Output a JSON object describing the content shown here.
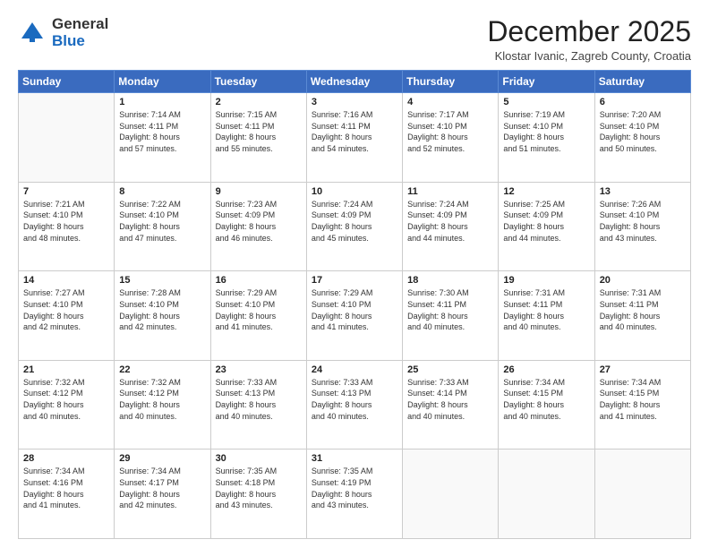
{
  "logo": {
    "general": "General",
    "blue": "Blue"
  },
  "header": {
    "month": "December 2025",
    "location": "Klostar Ivanic, Zagreb County, Croatia"
  },
  "weekdays": [
    "Sunday",
    "Monday",
    "Tuesday",
    "Wednesday",
    "Thursday",
    "Friday",
    "Saturday"
  ],
  "weeks": [
    [
      {
        "day": null,
        "detail": ""
      },
      {
        "day": "1",
        "detail": "Sunrise: 7:14 AM\nSunset: 4:11 PM\nDaylight: 8 hours\nand 57 minutes."
      },
      {
        "day": "2",
        "detail": "Sunrise: 7:15 AM\nSunset: 4:11 PM\nDaylight: 8 hours\nand 55 minutes."
      },
      {
        "day": "3",
        "detail": "Sunrise: 7:16 AM\nSunset: 4:11 PM\nDaylight: 8 hours\nand 54 minutes."
      },
      {
        "day": "4",
        "detail": "Sunrise: 7:17 AM\nSunset: 4:10 PM\nDaylight: 8 hours\nand 52 minutes."
      },
      {
        "day": "5",
        "detail": "Sunrise: 7:19 AM\nSunset: 4:10 PM\nDaylight: 8 hours\nand 51 minutes."
      },
      {
        "day": "6",
        "detail": "Sunrise: 7:20 AM\nSunset: 4:10 PM\nDaylight: 8 hours\nand 50 minutes."
      }
    ],
    [
      {
        "day": "7",
        "detail": "Sunrise: 7:21 AM\nSunset: 4:10 PM\nDaylight: 8 hours\nand 48 minutes."
      },
      {
        "day": "8",
        "detail": "Sunrise: 7:22 AM\nSunset: 4:10 PM\nDaylight: 8 hours\nand 47 minutes."
      },
      {
        "day": "9",
        "detail": "Sunrise: 7:23 AM\nSunset: 4:09 PM\nDaylight: 8 hours\nand 46 minutes."
      },
      {
        "day": "10",
        "detail": "Sunrise: 7:24 AM\nSunset: 4:09 PM\nDaylight: 8 hours\nand 45 minutes."
      },
      {
        "day": "11",
        "detail": "Sunrise: 7:24 AM\nSunset: 4:09 PM\nDaylight: 8 hours\nand 44 minutes."
      },
      {
        "day": "12",
        "detail": "Sunrise: 7:25 AM\nSunset: 4:09 PM\nDaylight: 8 hours\nand 44 minutes."
      },
      {
        "day": "13",
        "detail": "Sunrise: 7:26 AM\nSunset: 4:10 PM\nDaylight: 8 hours\nand 43 minutes."
      }
    ],
    [
      {
        "day": "14",
        "detail": "Sunrise: 7:27 AM\nSunset: 4:10 PM\nDaylight: 8 hours\nand 42 minutes."
      },
      {
        "day": "15",
        "detail": "Sunrise: 7:28 AM\nSunset: 4:10 PM\nDaylight: 8 hours\nand 42 minutes."
      },
      {
        "day": "16",
        "detail": "Sunrise: 7:29 AM\nSunset: 4:10 PM\nDaylight: 8 hours\nand 41 minutes."
      },
      {
        "day": "17",
        "detail": "Sunrise: 7:29 AM\nSunset: 4:10 PM\nDaylight: 8 hours\nand 41 minutes."
      },
      {
        "day": "18",
        "detail": "Sunrise: 7:30 AM\nSunset: 4:11 PM\nDaylight: 8 hours\nand 40 minutes."
      },
      {
        "day": "19",
        "detail": "Sunrise: 7:31 AM\nSunset: 4:11 PM\nDaylight: 8 hours\nand 40 minutes."
      },
      {
        "day": "20",
        "detail": "Sunrise: 7:31 AM\nSunset: 4:11 PM\nDaylight: 8 hours\nand 40 minutes."
      }
    ],
    [
      {
        "day": "21",
        "detail": "Sunrise: 7:32 AM\nSunset: 4:12 PM\nDaylight: 8 hours\nand 40 minutes."
      },
      {
        "day": "22",
        "detail": "Sunrise: 7:32 AM\nSunset: 4:12 PM\nDaylight: 8 hours\nand 40 minutes."
      },
      {
        "day": "23",
        "detail": "Sunrise: 7:33 AM\nSunset: 4:13 PM\nDaylight: 8 hours\nand 40 minutes."
      },
      {
        "day": "24",
        "detail": "Sunrise: 7:33 AM\nSunset: 4:13 PM\nDaylight: 8 hours\nand 40 minutes."
      },
      {
        "day": "25",
        "detail": "Sunrise: 7:33 AM\nSunset: 4:14 PM\nDaylight: 8 hours\nand 40 minutes."
      },
      {
        "day": "26",
        "detail": "Sunrise: 7:34 AM\nSunset: 4:15 PM\nDaylight: 8 hours\nand 40 minutes."
      },
      {
        "day": "27",
        "detail": "Sunrise: 7:34 AM\nSunset: 4:15 PM\nDaylight: 8 hours\nand 41 minutes."
      }
    ],
    [
      {
        "day": "28",
        "detail": "Sunrise: 7:34 AM\nSunset: 4:16 PM\nDaylight: 8 hours\nand 41 minutes."
      },
      {
        "day": "29",
        "detail": "Sunrise: 7:34 AM\nSunset: 4:17 PM\nDaylight: 8 hours\nand 42 minutes."
      },
      {
        "day": "30",
        "detail": "Sunrise: 7:35 AM\nSunset: 4:18 PM\nDaylight: 8 hours\nand 43 minutes."
      },
      {
        "day": "31",
        "detail": "Sunrise: 7:35 AM\nSunset: 4:19 PM\nDaylight: 8 hours\nand 43 minutes."
      },
      {
        "day": null,
        "detail": ""
      },
      {
        "day": null,
        "detail": ""
      },
      {
        "day": null,
        "detail": ""
      }
    ]
  ]
}
